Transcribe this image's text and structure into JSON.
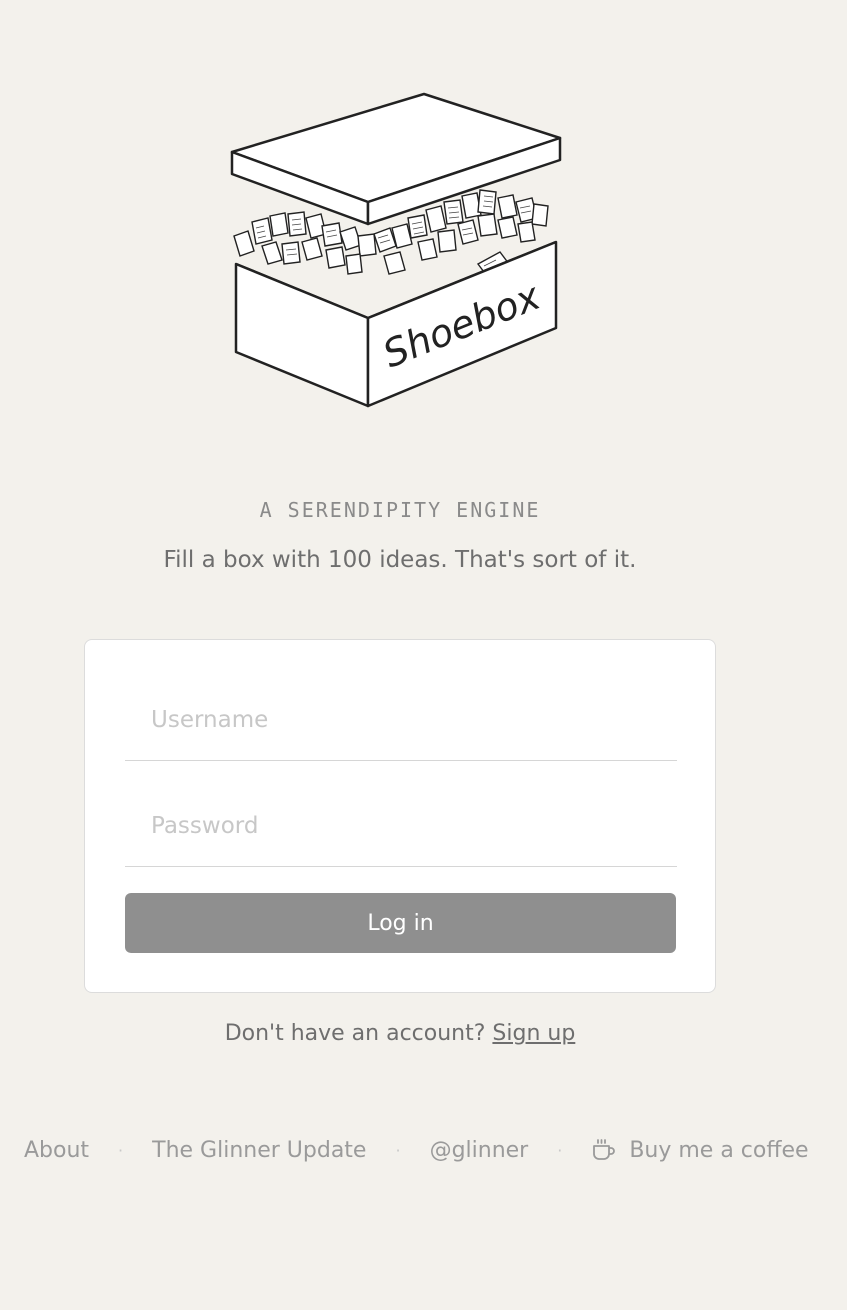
{
  "tagline": "A SERENDIPITY ENGINE",
  "subtitle": "Fill a box with 100 ideas. That's sort of it.",
  "logo": {
    "label": "Shoebox",
    "icon": "shoebox-logo-icon"
  },
  "login_form": {
    "username_placeholder": "Username",
    "username_value": "",
    "password_placeholder": "Password",
    "password_value": "",
    "login_label": "Log in"
  },
  "signup": {
    "prompt": "Don't have an account?",
    "link_label": "Sign up"
  },
  "footer": {
    "about": "About",
    "newsletter": "The Glinner Update",
    "handle": "@glinner",
    "coffee": "Buy me a coffee",
    "separator": "·",
    "coffee_icon": "coffee-cup-icon"
  },
  "colors": {
    "background": "#f3f1ec",
    "card": "#ffffff",
    "button": "#8f8f8f"
  }
}
